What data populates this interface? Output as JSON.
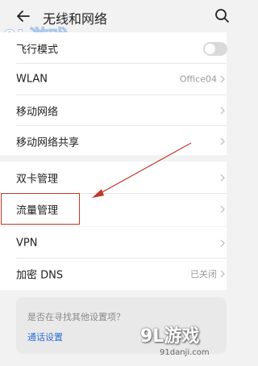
{
  "header": {
    "title": "无线和网络"
  },
  "watermark": {
    "top_text": "9L游戏",
    "bottom_main": "9L游戏",
    "bottom_sub": "91danji.com"
  },
  "rows": [
    {
      "label": "飞行模式",
      "value": "",
      "control": "toggle",
      "toggle_on": false
    },
    {
      "label": "WLAN",
      "value": "Office04"
    },
    {
      "label": "移动网络",
      "value": ""
    },
    {
      "label": "移动网络共享",
      "value": ""
    },
    {
      "label": "双卡管理",
      "value": ""
    },
    {
      "label": "流量管理",
      "value": ""
    },
    {
      "label": "VPN",
      "value": ""
    },
    {
      "label": "加密 DNS",
      "value": "已关闭"
    }
  ],
  "suggestion": {
    "question": "是否在寻找其他设置项？",
    "link": "通话设置"
  },
  "colors": {
    "background": "#f2f2f2",
    "card": "#ffffff",
    "annotation_red": "#c0392b",
    "link_blue": "#2a6fdb"
  }
}
